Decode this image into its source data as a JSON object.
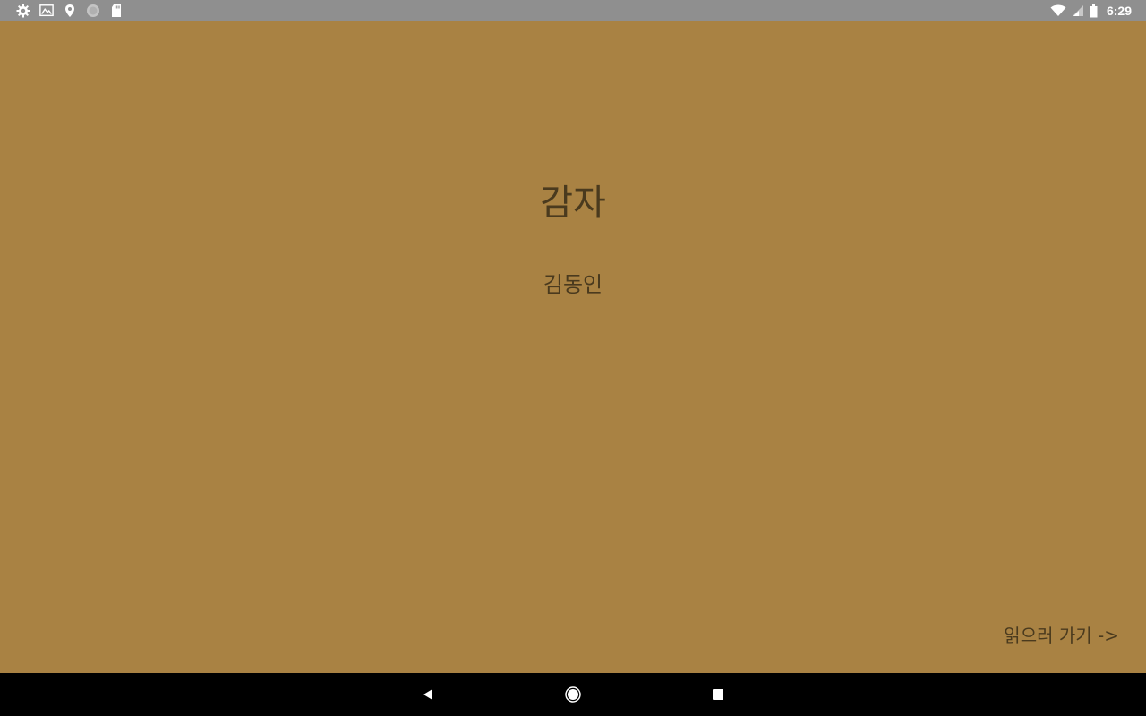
{
  "status_bar": {
    "time": "6:29",
    "left_icons": [
      "settings-icon",
      "gallery-icon",
      "location-icon",
      "sync-circle-icon",
      "sd-card-icon"
    ],
    "right_icons": [
      "wifi-icon",
      "cell-signal-icon",
      "battery-icon"
    ]
  },
  "book": {
    "title": "감자",
    "author": "김동인",
    "read_label": "읽으러 가기 ->"
  },
  "colors": {
    "background": "#a98243",
    "text": "#4a3a1e",
    "status_bar": "#8f8f8f",
    "nav_bar": "#000000"
  },
  "nav_bar": {
    "buttons": [
      "back-icon",
      "home-icon",
      "recents-icon"
    ]
  }
}
